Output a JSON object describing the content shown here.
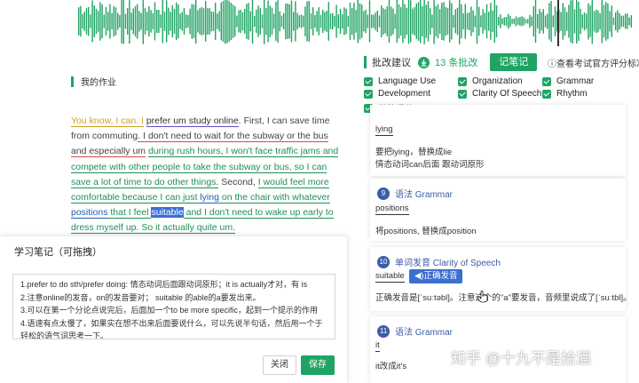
{
  "header": {
    "title": "批改建议",
    "count": "13 条批改",
    "note_button": "记笔记",
    "standard_link": "查看考试官方评分标准"
  },
  "my_work_title": "我的作业",
  "categories": [
    "Language Use",
    "Organization",
    "Grammar",
    "Development",
    "Clarity Of Speech",
    "Rhythm",
    "总体评价"
  ],
  "essay": [
    {
      "t": "You know, I can. I",
      "s": "y"
    },
    {
      "t": " ",
      "s": ""
    },
    {
      "t": "prefer um study online",
      "s": "pu"
    },
    {
      "t": ". First, I can save time from commuting",
      "s": ""
    },
    {
      "t": ". I don't need to wait for the subway or the bus and especially um",
      "s": "r"
    },
    {
      "t": " ",
      "s": ""
    },
    {
      "t": "during rush hours, I won't face traffic jams and compete with other people to take the subway or bus, so I can save a lot of time to do other things.",
      "s": "g"
    },
    {
      "t": " Second, ",
      "s": ""
    },
    {
      "t": "I would feel more comfortable because I can just ",
      "s": "g"
    },
    {
      "t": "lying",
      "s": "b"
    },
    {
      "t": " on the chair with whatever ",
      "s": "g"
    },
    {
      "t": "positions",
      "s": "b"
    },
    {
      "t": " that I feel ",
      "s": "g"
    },
    {
      "t": "suitable",
      "s": "hl"
    },
    {
      "t": " and I don't need to wake up early to dress myself up. So it actually quite um.",
      "s": "g"
    }
  ],
  "notes": {
    "title": "学习笔记（可拖拽）",
    "content": "1.prefer to do sth/prefer doing: 情态动词后面跟动词原形；it is actually才对，有 is\n2.注意online的发音，on的发音要对； suitable 的able的a要发出来。\n3.可以在第一个分论点说完后，后面加一个to be more specific，起到一个提示的作用\n4.语速有点太慢了，如果实在想不出来后面要说什么，可以先说半句话，然后用一个于轻松的语气词思考一下。",
    "close": "关闭",
    "save": "保存"
  },
  "cards": [
    {
      "word": "lying",
      "lines": [
        "要把lying，替换成lie",
        "情态动词can后面 跟动词原形"
      ]
    },
    {
      "num": "9",
      "title": "语法 Grammar",
      "word": "positions",
      "lines": [
        "将positions, 替换成position"
      ]
    },
    {
      "num": "10",
      "title": "单词发音 Clarity of Speech",
      "word": "suitable",
      "button": "◀)正确发音",
      "lines": [
        "正确发音是[ˈsuːtəbl]。注意这个的\"a\"要发音，音频里说成了[ˈsuːtbl]。"
      ]
    },
    {
      "num": "11",
      "title": "语法 Grammar",
      "word": "it",
      "lines": [
        "it改成it's"
      ]
    }
  ],
  "watermark": "知乎 @十九不是拾酒",
  "colors": {
    "accent": "#1fa463",
    "blue": "#3b5ca8",
    "highlight": "#3a6fd8"
  }
}
